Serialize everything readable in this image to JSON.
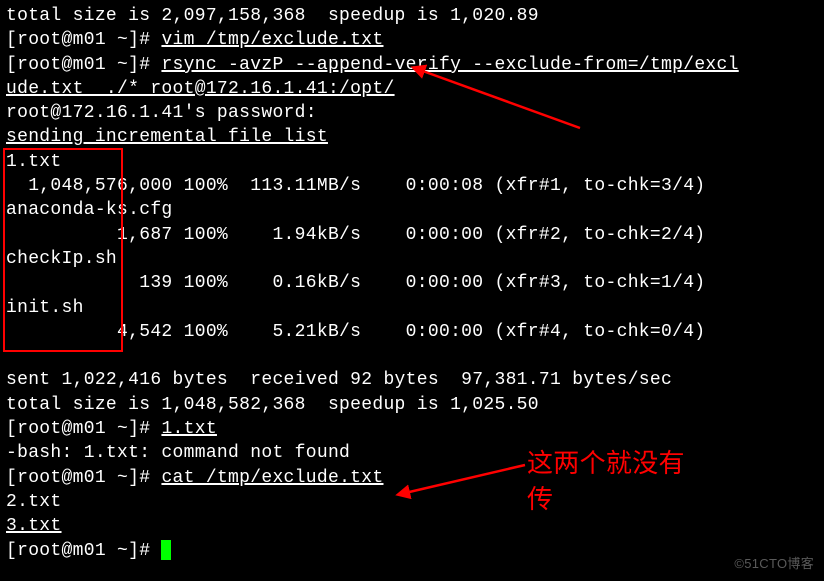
{
  "lines": {
    "l0": "total size is 2,097,158,368  speedup is 1,020.89",
    "l1a": "[root@m01 ~]# ",
    "l1b": "vim /tmp/exclude.txt",
    "l2a": "[root@m01 ~]# ",
    "l2b": "rsync -avzP --append-verify --exclude-from=/tmp/excl",
    "l3": "ude.txt  ./* root@172.16.1.41:/opt/",
    "l4": "root@172.16.1.41's password:",
    "l5": "sending incremental file list",
    "l6": "1.txt",
    "l7": "  1,048,576,000 100%  113.11MB/s    0:00:08 (xfr#1, to-chk=3/4)",
    "l8": "anaconda-ks.cfg",
    "l9": "          1,687 100%    1.94kB/s    0:00:00 (xfr#2, to-chk=2/4)",
    "l10": "checkIp.sh",
    "l11": "            139 100%    0.16kB/s    0:00:00 (xfr#3, to-chk=1/4)",
    "l12": "init.sh",
    "l13": "          4,542 100%    5.21kB/s    0:00:00 (xfr#4, to-chk=0/4)",
    "l14": "",
    "l15": "sent 1,022,416 bytes  received 92 bytes  97,381.71 bytes/sec",
    "l16": "total size is 1,048,582,368  speedup is 1,025.50",
    "l17a": "[root@m01 ~]# ",
    "l17b": "1.txt",
    "l18": "-bash: 1.txt: command not found",
    "l19a": "[root@m01 ~]# ",
    "l19b": "cat /tmp/exclude.txt",
    "l20": "2.txt",
    "l21": "3.txt",
    "l22": "[root@m01 ~]# "
  },
  "annotation": {
    "label1": "这两个就没有",
    "label2": "传"
  },
  "watermark": "©51CTO博客"
}
